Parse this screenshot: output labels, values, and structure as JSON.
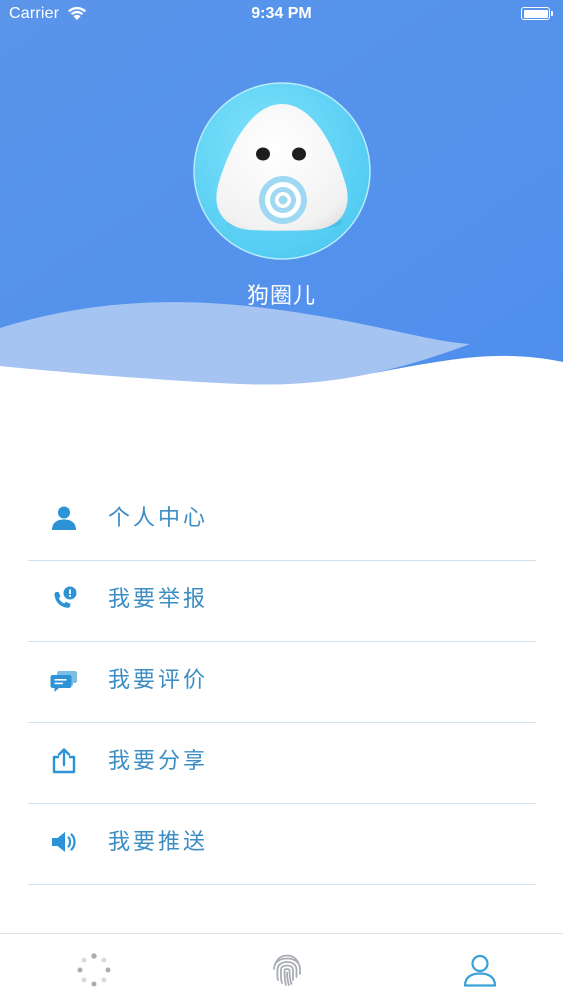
{
  "status_bar": {
    "carrier": "Carrier",
    "time": "9:34 PM",
    "battery_level": 1.0
  },
  "profile": {
    "app_name": "狗圈儿",
    "avatar_icon": "rice-ball-mascot-icon"
  },
  "menu": {
    "items": [
      {
        "label": "个人中心",
        "icon": "person-icon"
      },
      {
        "label": "我要举报",
        "icon": "phone-alert-icon"
      },
      {
        "label": "我要评价",
        "icon": "chat-bubbles-icon"
      },
      {
        "label": "我要分享",
        "icon": "share-icon"
      },
      {
        "label": "我要推送",
        "icon": "speaker-icon"
      }
    ]
  },
  "tabbar": {
    "tabs": [
      {
        "icon": "loading-dots-icon",
        "active": false
      },
      {
        "icon": "fingerprint-icon",
        "active": false
      },
      {
        "icon": "person-outline-icon",
        "active": true
      }
    ]
  },
  "colors": {
    "header_blue": "#5a95ea",
    "wave_light": "#a6c4f2",
    "menu_text": "#3c8dc4",
    "menu_icon": "#2b93d6",
    "divider": "#cfe2ee",
    "tab_inactive": "#a9adb3",
    "tab_active": "#3aa0d8",
    "avatar_bg": "#5fd3f4"
  }
}
